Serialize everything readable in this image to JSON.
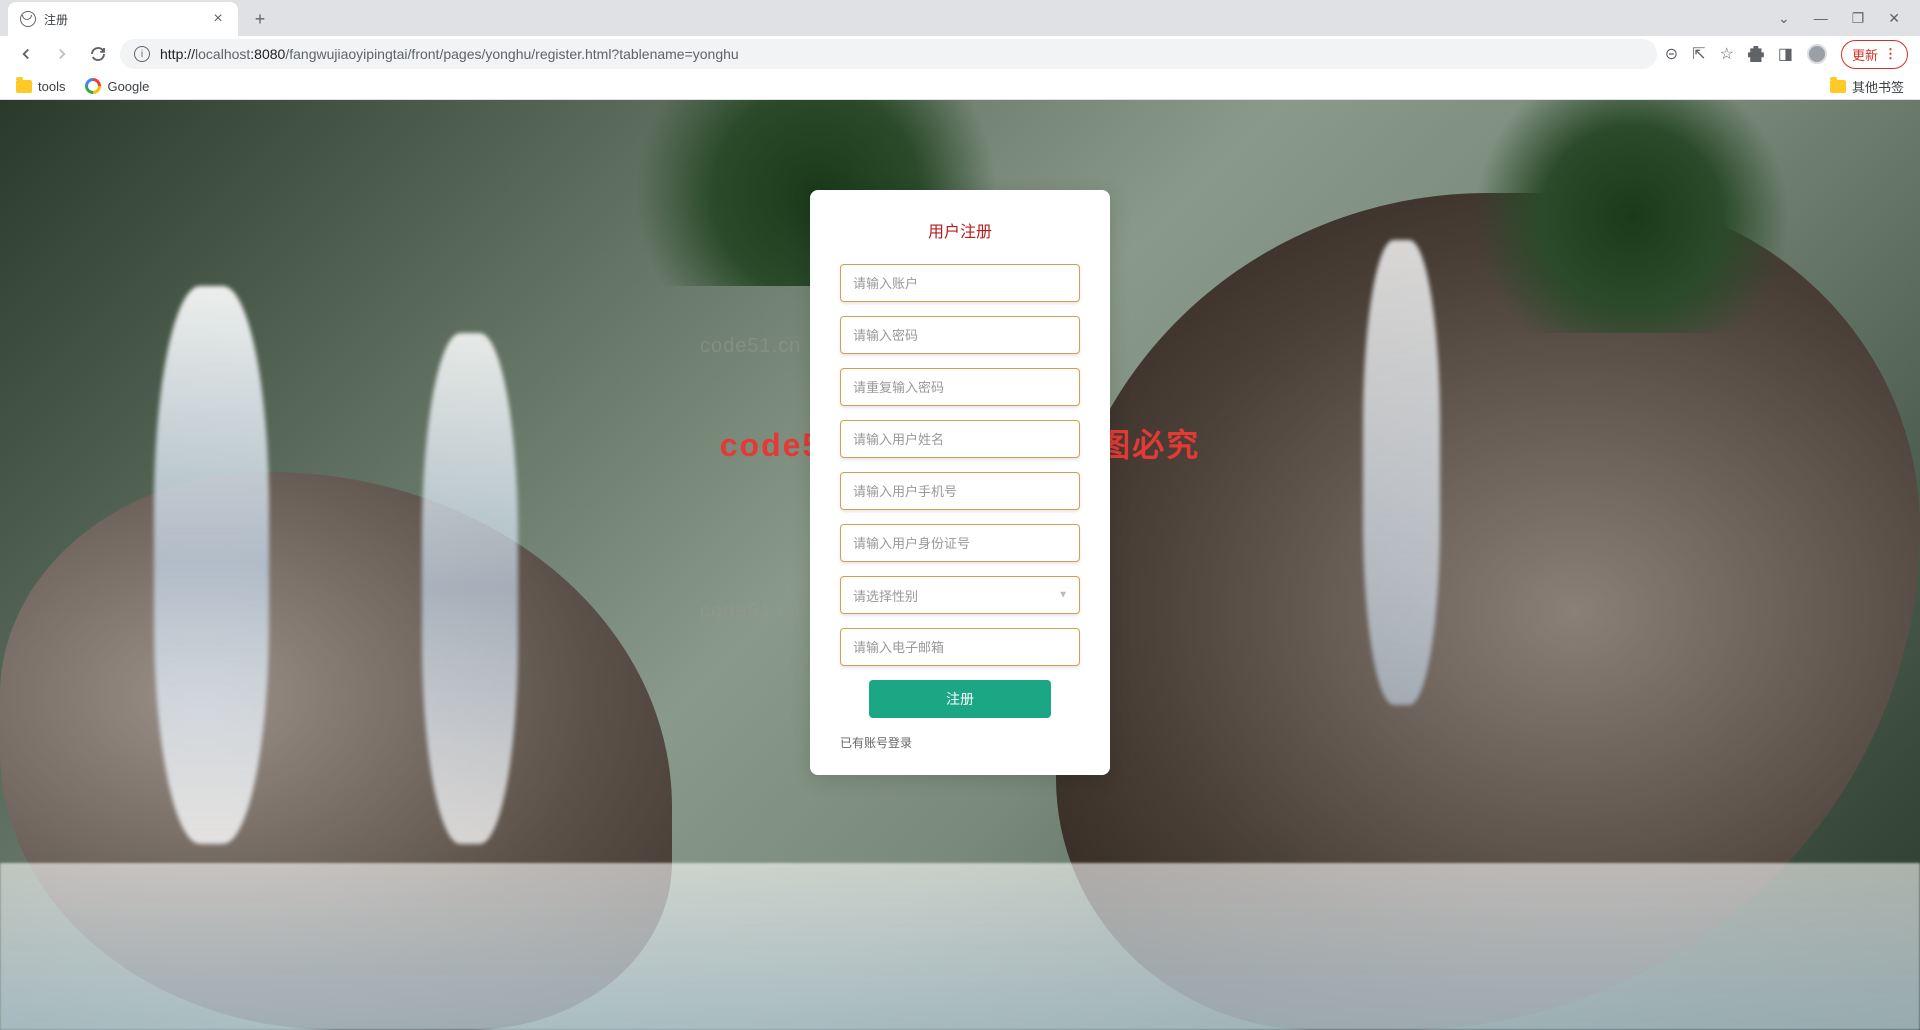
{
  "browser": {
    "tab_title": "注册",
    "url_host": "localhost",
    "url_port": ":8080",
    "url_path": "/fangwujiaoyipingtai/front/pages/yonghu/register.html?tablename=yonghu",
    "update_label": "更新",
    "bookmarks": {
      "tools": "tools",
      "google": "Google",
      "other": "其他书签"
    }
  },
  "watermarks": {
    "text": "code51.cn",
    "red_text": "code51.cn—源码乐园盗图必究"
  },
  "register": {
    "title": "用户注册",
    "fields": {
      "account": "请输入账户",
      "password": "请输入密码",
      "password_confirm": "请重复输入密码",
      "name": "请输入用户姓名",
      "phone": "请输入用户手机号",
      "idcard": "请输入用户身份证号",
      "gender": "请选择性别",
      "email": "请输入电子邮箱"
    },
    "submit_label": "注册",
    "login_link": "已有账号登录"
  }
}
